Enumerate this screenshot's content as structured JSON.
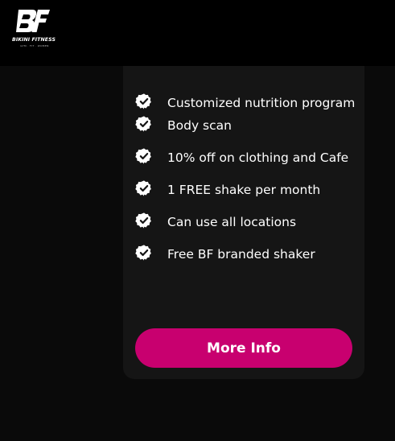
{
  "header": {
    "logo": {
      "monogram": "BF",
      "brand_name": "BIKINI FITNESS",
      "tagline": "GYM · FIT · WOMEN"
    }
  },
  "plan_card": {
    "features": [
      {
        "text": "Customized nutrition program",
        "icon": "badge-check-icon"
      },
      {
        "text": "Body scan",
        "icon": "badge-check-icon"
      },
      {
        "text": "10% off on clothing and Cafe",
        "icon": "badge-check-icon"
      },
      {
        "text": "1 FREE shake per month",
        "icon": "badge-check-icon"
      },
      {
        "text": "Can use all locations",
        "icon": "badge-check-icon"
      },
      {
        "text": "Free BF branded shaker",
        "icon": "badge-check-icon"
      }
    ],
    "cta_label": "More Info"
  },
  "colors": {
    "page_background": "#0a0a0a",
    "header_background": "#000000",
    "card_background": "#151515",
    "accent": "#c8006f",
    "text": "#ffffff"
  }
}
